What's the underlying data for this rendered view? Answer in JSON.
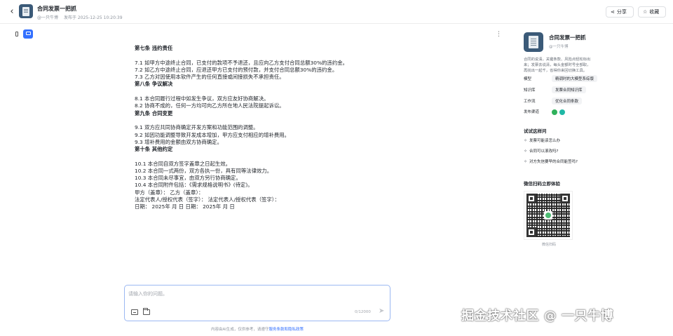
{
  "header": {
    "title": "合同发票一把抓",
    "author": "@一只牛博",
    "published": "发布于 2025-12-25 10:20:39",
    "share_label": "分享",
    "favorite_label": "收藏"
  },
  "document": {
    "lines": [
      {
        "text": "第七条 违约责任",
        "heading": true
      },
      {
        "text": "",
        "gap": true
      },
      {
        "text": "7.1 如甲方中途终止合同，已支付的款项不予退还，且应向乙方支付合同总额30%的违约金。"
      },
      {
        "text": "7.2 如乙方中途终止合同，应退还甲方已支付的预付款，并支付合同总额30%的违约金。"
      },
      {
        "text": "7.3 乙方对因使用本软件产生的任何直接或间接损失不承担责任。"
      },
      {
        "text": "第八条 争议解决",
        "heading": true
      },
      {
        "text": "",
        "gap": true
      },
      {
        "text": "8.1 本合同履行过程中如发生争议，双方应友好协商解决。"
      },
      {
        "text": "8.2 协商不成的，任何一方均可向乙方所在地人民法院提起诉讼。"
      },
      {
        "text": "第九条 合同变更",
        "heading": true
      },
      {
        "text": "",
        "gap": true
      },
      {
        "text": "9.1 双方应共同协商确定开发方案和功能范围的调整。"
      },
      {
        "text": "9.2 如因功能调整导致开发成本增加，甲方应支付相应的增补费用。"
      },
      {
        "text": "9.3 增补费用的金额由双方协商确定。"
      },
      {
        "text": "第十条 其他约定",
        "heading": true
      },
      {
        "text": "",
        "gap": true
      },
      {
        "text": "10.1 本合同自双方签字盖章之日起生效。"
      },
      {
        "text": "10.2 本合同一式两份，双方各执一份，具有同等法律效力。"
      },
      {
        "text": "10.3 本合同未尽事宜，由双方另行协商确定。"
      },
      {
        "text": "10.4 本合同附件包括：《需求规格说明书》(待定)。"
      },
      {
        "text": "甲方（盖章）： 乙方（盖章）："
      },
      {
        "text": "法定代表人/授权代表（签字）： 法定代表人/授权代表（签字）："
      },
      {
        "text": "日期： 2025年 月 日 日期： 2025年 月 日"
      }
    ]
  },
  "chat": {
    "placeholder": "请输入你的问题。",
    "char_count": "0/12000",
    "disclaimer_prefix": "内容由AI生成，仅供参考，请遵守",
    "disclaimer_link": "服务条款和隐私政策"
  },
  "agent": {
    "name": "合同发票一把抓",
    "author": "@一只牛博",
    "description": "合同的说清，关键条款、风险点轻松标出来；发票去说清，每头金额时号全部取，再找出一起千，省得你来回切换工具。",
    "meta": [
      {
        "label": "模型",
        "value": "精调时的大模型系综版"
      },
      {
        "label": "知识库",
        "value": "发票合同知识库"
      },
      {
        "label": "工作流",
        "value": "优化合同条款"
      },
      {
        "label": "发布渠道",
        "value": ""
      }
    ],
    "channel_colors": [
      "#2fb15b",
      "#20b8a6"
    ],
    "suggest_title": "试试这样问",
    "suggestions": [
      "发票可能该怎么办",
      "合同可以滚改吗?",
      "对方失信要早的合同能签吗?"
    ],
    "qr_title": "微信扫码立即体验",
    "qr_caption": "微信扫码"
  },
  "watermark": "掘金技术社区 @ 一只牛博",
  "colors": {
    "accent": "#3370ff",
    "avatar_bg": "#3b5a78"
  }
}
